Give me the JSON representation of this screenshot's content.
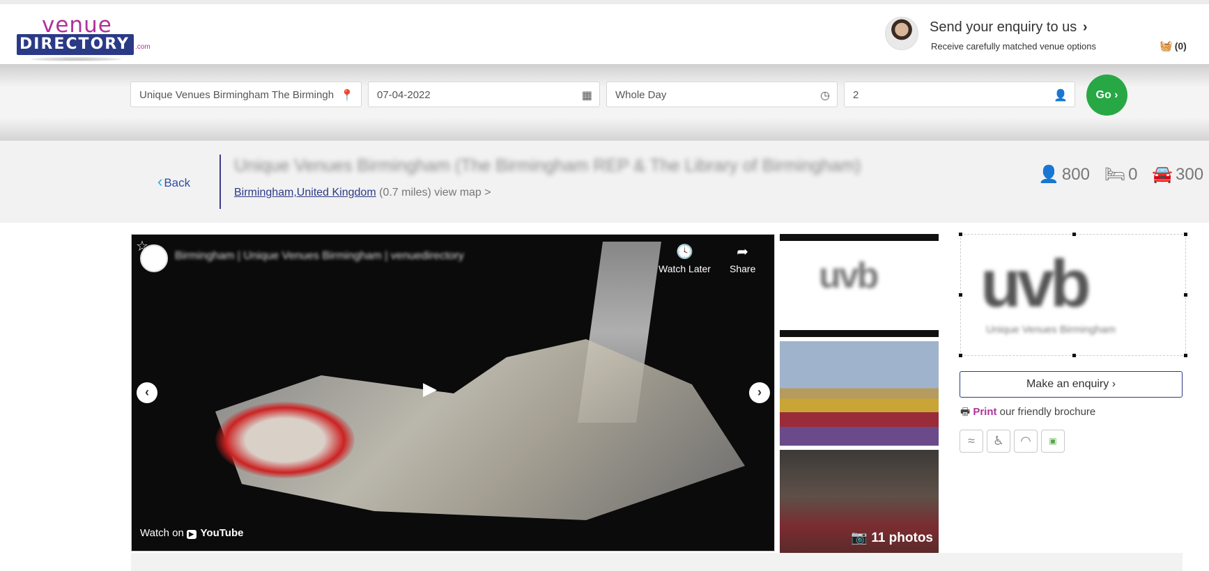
{
  "header": {
    "logo_top": "venue",
    "logo_main": "DIRECTORY",
    "logo_suffix": ".com",
    "enquiry_title": "Send your enquiry to us",
    "enquiry_chevron": "›",
    "enquiry_subtitle": "Receive carefully matched venue options",
    "basket_count": "(0)",
    "basket_icon": "basket-icon"
  },
  "search": {
    "location": "Unique Venues Birmingham The Birmingh",
    "date": "07-04-2022",
    "time": "Whole Day",
    "guests": "2",
    "go_label": "Go ›",
    "icons": [
      "location-pin-icon",
      "calendar-icon",
      "clock-icon",
      "person-icon"
    ]
  },
  "venue": {
    "back_label": "Back",
    "title": "Unique Venues Birmingham (The Birmingham REP & The Library of Birmingham)",
    "location_link": "Birmingham,United Kingdom",
    "distance": "(0.7 miles)",
    "view_map": "view map >",
    "stats": {
      "capacity": "800",
      "bedrooms": "0",
      "parking": "300"
    }
  },
  "video": {
    "title": "Birmingham | Unique Venues Birmingham | venuedirectory",
    "watch_later": "Watch Later",
    "share": "Share",
    "watch_on": "Watch on",
    "youtube": "YouTube",
    "play_icon": "play-icon"
  },
  "gallery": {
    "photos_label": "11 photos",
    "thumb_logo_text": "uvb"
  },
  "sidebar": {
    "logo_text": "uvb",
    "logo_caption": "Unique Venues Birmingham",
    "enquiry_button": "Make an enquiry ›",
    "print_label": "Print",
    "print_rest": " our friendly brochure",
    "amenities": [
      "swimming-icon",
      "wheelchair-icon",
      "wifi-icon",
      "safe-icon"
    ]
  },
  "colors": {
    "brand_purple": "#b0319a",
    "brand_navy": "#2b3a86",
    "go_green": "#27a844"
  }
}
